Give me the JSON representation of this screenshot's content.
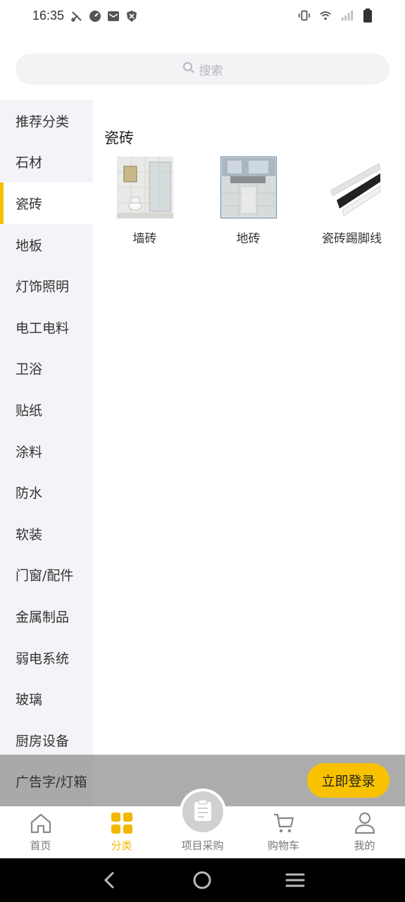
{
  "status_bar": {
    "time": "16:35",
    "left_icons": [
      "scissors-icon",
      "speedometer-icon",
      "mail-icon",
      "shield-icon"
    ],
    "right_icons": [
      "vibrate-icon",
      "wifi-icon",
      "signal-icon",
      "battery-icon"
    ]
  },
  "search": {
    "placeholder": "搜索"
  },
  "sidebar": {
    "items": [
      {
        "label": "推荐分类",
        "active": false
      },
      {
        "label": "石材",
        "active": false
      },
      {
        "label": "瓷砖",
        "active": true
      },
      {
        "label": "地板",
        "active": false
      },
      {
        "label": "灯饰照明",
        "active": false
      },
      {
        "label": "电工电料",
        "active": false
      },
      {
        "label": "卫浴",
        "active": false
      },
      {
        "label": "贴纸",
        "active": false
      },
      {
        "label": "涂料",
        "active": false
      },
      {
        "label": "防水",
        "active": false
      },
      {
        "label": "软装",
        "active": false
      },
      {
        "label": "门窗/配件",
        "active": false
      },
      {
        "label": "金属制品",
        "active": false
      },
      {
        "label": "弱电系统",
        "active": false
      },
      {
        "label": "玻璃",
        "active": false
      },
      {
        "label": "厨房设备",
        "active": false
      }
    ],
    "last_item": "广告字/灯箱"
  },
  "content": {
    "section_title": "瓷砖",
    "subcategories": [
      {
        "label": "墙砖",
        "image": "wall-tile-bathroom-image"
      },
      {
        "label": "地砖",
        "image": "floor-tile-livingroom-image"
      },
      {
        "label": "瓷砖踢脚线",
        "image": "skirting-line-image"
      }
    ]
  },
  "login_bar": {
    "button_label": "立即登录"
  },
  "tabbar": {
    "tabs": [
      {
        "label": "首页",
        "icon": "home-icon",
        "active": false
      },
      {
        "label": "分类",
        "icon": "category-grid-icon",
        "active": true
      },
      {
        "label": "项目采购",
        "icon": "clipboard-icon",
        "active": false
      },
      {
        "label": "购物车",
        "icon": "cart-icon",
        "active": false
      },
      {
        "label": "我的",
        "icon": "user-icon",
        "active": false
      }
    ],
    "accent_color": "#f2b800"
  },
  "navbar": {
    "buttons": [
      "back-icon",
      "home-circle-icon",
      "menu-icon"
    ]
  },
  "colors": {
    "accent": "#f5c000",
    "sidebar_bg": "#f4f4f8",
    "search_bg": "#f3f3f6"
  }
}
